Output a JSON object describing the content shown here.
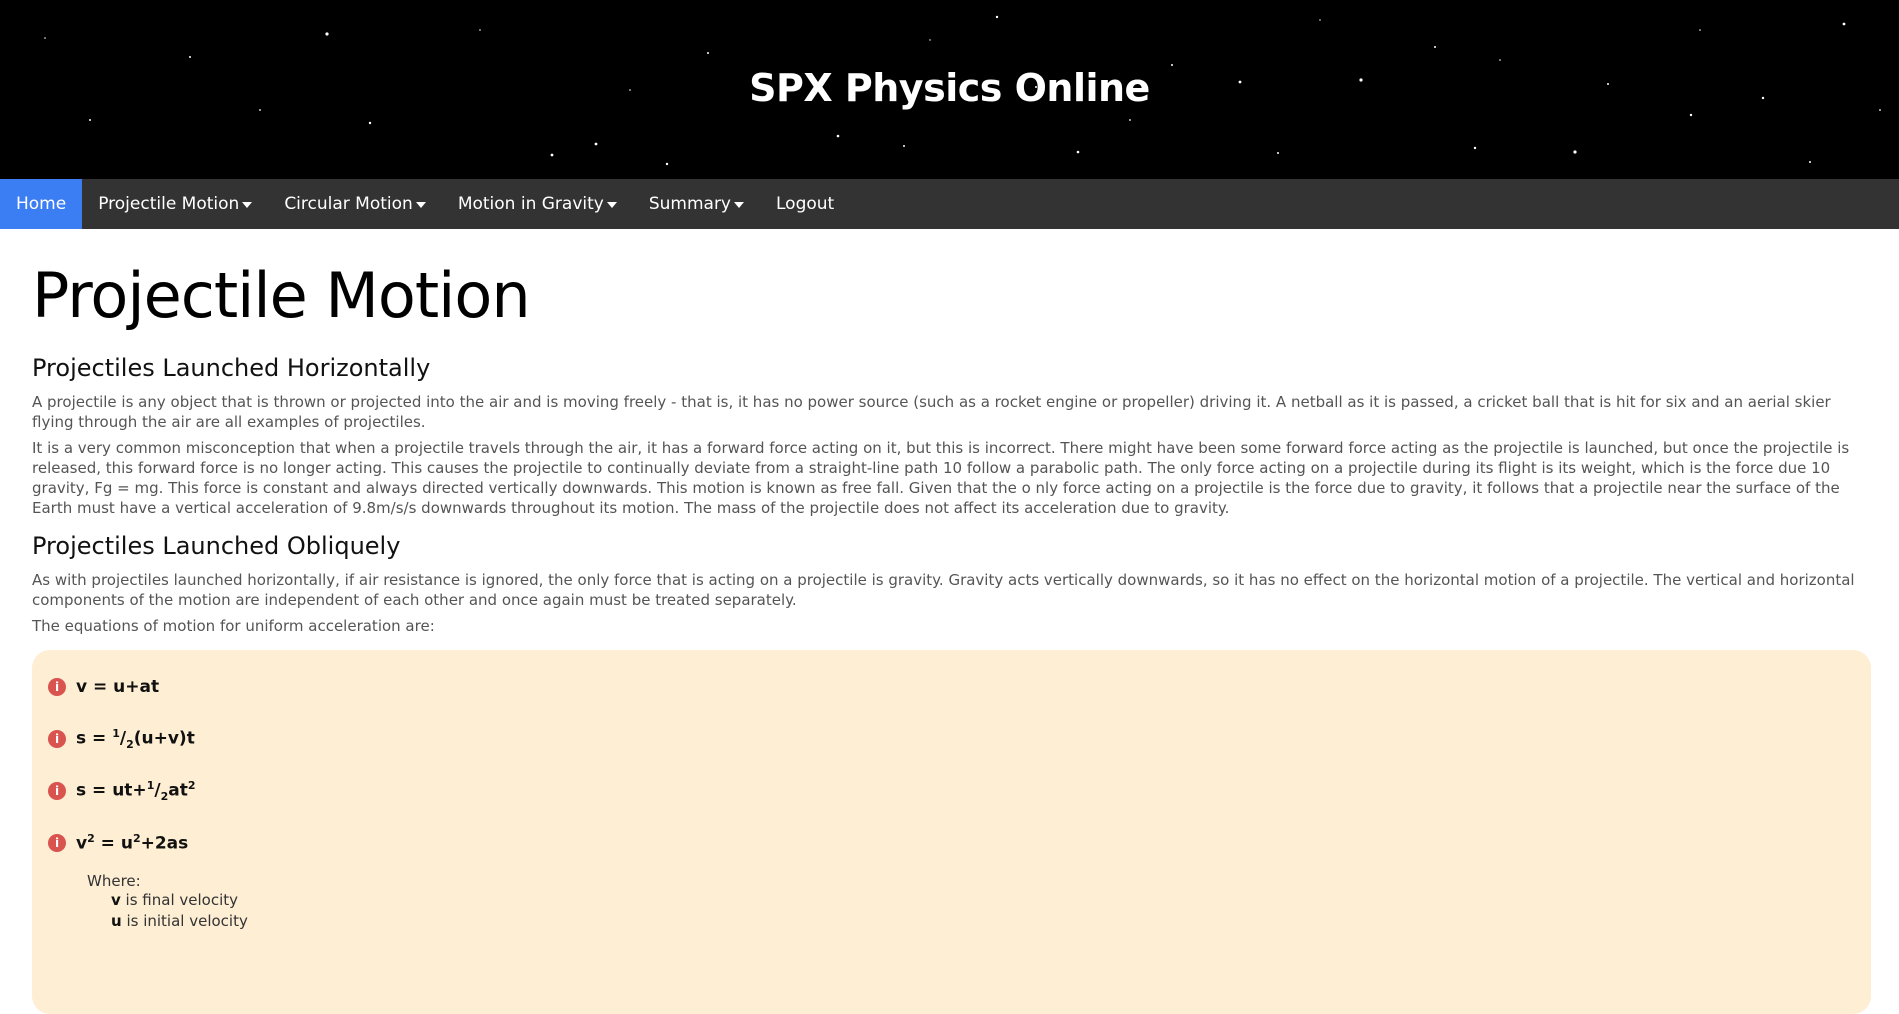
{
  "header": {
    "site_title": "SPX Physics Online"
  },
  "nav": {
    "items": [
      {
        "label": "Home",
        "active": true,
        "dropdown": false
      },
      {
        "label": "Projectile Motion",
        "active": false,
        "dropdown": true
      },
      {
        "label": "Circular Motion",
        "active": false,
        "dropdown": true
      },
      {
        "label": "Motion in Gravity",
        "active": false,
        "dropdown": true
      },
      {
        "label": "Summary",
        "active": false,
        "dropdown": true
      },
      {
        "label": "Logout",
        "active": false,
        "dropdown": false
      }
    ]
  },
  "main": {
    "title": "Projectile Motion",
    "sections": [
      {
        "heading": "Projectiles Launched Horizontally",
        "paragraphs": [
          "A projectile is any object that is thrown or projected into the air and is moving freely - that is, it has no power source (such as a rocket engine or propeller) driving it. A netball as it is passed, a cricket ball that is hit for six and an aerial skier flying through the air are all examples of projectiles.",
          "It is a very common misconception that when a projectile travels through the air, it has a forward force acting on it, but this is incorrect. There might have been some forward force acting as the projectile is launched, but once the projectile is released, this forward force is no longer acting. This causes the projectile to continually deviate from a straight-line path 10 follow a parabolic path. The only force acting on a projectile during its flight is its weight, which is the force due 10 gravity, Fg = mg. This force is constant and always directed vertically downwards. This motion is known as free fall. Given that the o nly force acting on a projectile is the force due to gravity, it follows that a projectile near the surface of the Earth must have a vertical acceleration of 9.8m/s/s downwards throughout its motion. The mass of the projectile does not affect its acceleration due to gravity."
        ]
      },
      {
        "heading": "Projectiles Launched Obliquely",
        "paragraphs": [
          "As with projectiles launched horizontally, if air resistance is ignored, the only force that is acting on a projectile is gravity. Gravity acts vertically downwards, so it has no effect on the horizontal motion of a projectile. The vertical and horizontal components of the motion are independent of each other and once again must be treated separately.",
          "The equations of motion for uniform acceleration are:"
        ]
      }
    ],
    "equations_box": {
      "icon": "info-icon",
      "icon_glyph": "i",
      "eq1": "v = u+at",
      "eq2_a": "s = ",
      "eq2_num": "1",
      "eq2_den": "2",
      "eq2_b": "(u+v)t",
      "eq3_a": "s = ut+",
      "eq3_num": "1",
      "eq3_den": "2",
      "eq3_b": "at",
      "eq3_exp": "2",
      "eq4_a": "v",
      "eq4_exp1": "2",
      "eq4_b": " = u",
      "eq4_exp2": "2",
      "eq4_c": "+2as",
      "where_label": "Where:",
      "definitions": [
        {
          "symbol": "v",
          "text": " is final velocity"
        },
        {
          "symbol": "u",
          "text": " is initial velocity"
        }
      ]
    }
  },
  "colors": {
    "header_bg": "#000000",
    "nav_bg": "#333333",
    "nav_active": "#3b7df3",
    "box_bg": "#fdeed4",
    "icon": "#d9534f"
  }
}
